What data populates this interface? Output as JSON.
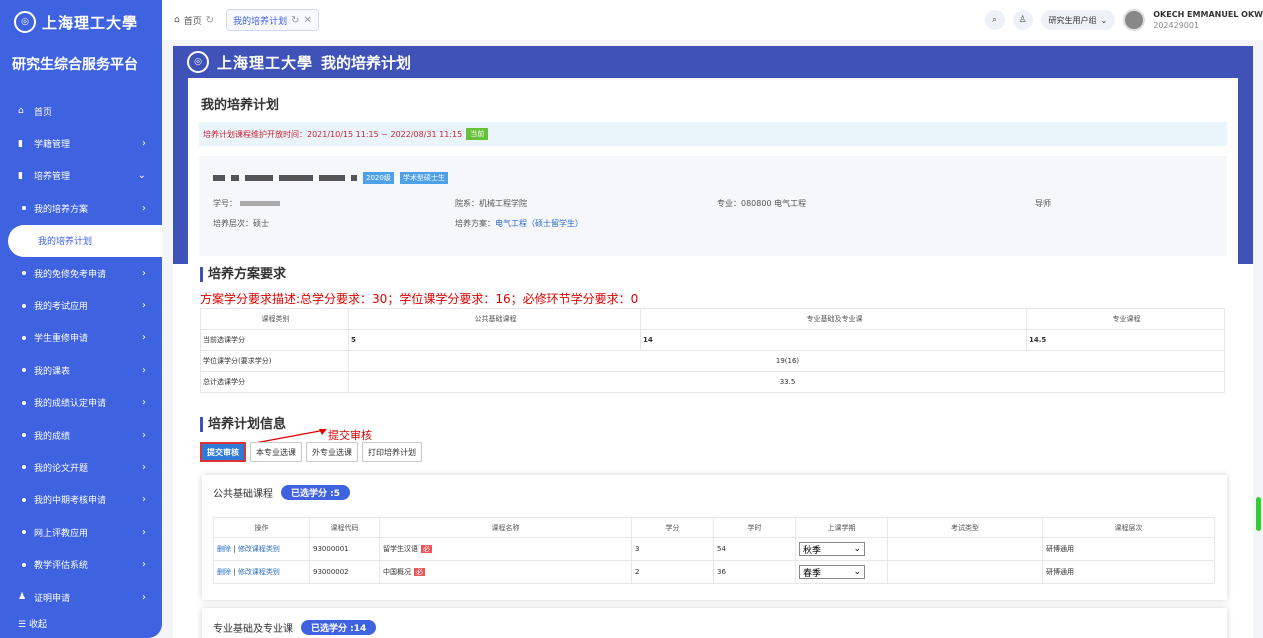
{
  "sidebar": {
    "logo_text": "上海理工大學",
    "platform_title": "研究生综合服务平台",
    "items": [
      {
        "label": "首页",
        "icon": "home-icon",
        "level": "top",
        "chevron": ""
      },
      {
        "label": "学籍管理",
        "icon": "chart-icon",
        "level": "top",
        "chevron": "›"
      },
      {
        "label": "培养管理",
        "icon": "chart-icon",
        "level": "top",
        "chevron": "⌄"
      },
      {
        "label": "我的培养方案",
        "level": "sub",
        "chevron": "›"
      },
      {
        "label": "我的培养计划",
        "level": "active",
        "chevron": ""
      },
      {
        "label": "我的免修免考申请",
        "level": "sub",
        "chevron": "›"
      },
      {
        "label": "我的考试应用",
        "level": "sub",
        "chevron": "›"
      },
      {
        "label": "学生重修申请",
        "level": "sub",
        "chevron": "›"
      },
      {
        "label": "我的课表",
        "level": "sub",
        "chevron": "›"
      },
      {
        "label": "我的成绩认定申请",
        "level": "sub",
        "chevron": "›"
      },
      {
        "label": "我的成绩",
        "level": "sub",
        "chevron": "›"
      },
      {
        "label": "我的论文开题",
        "level": "sub",
        "chevron": "›"
      },
      {
        "label": "我的中期考核申请",
        "level": "sub",
        "chevron": "›"
      },
      {
        "label": "网上评教应用",
        "level": "sub",
        "chevron": "›"
      },
      {
        "label": "教学评估系统",
        "level": "sub",
        "chevron": "›"
      },
      {
        "label": "证明申请",
        "icon": "person-icon",
        "level": "top",
        "chevron": "›"
      }
    ],
    "collapse_label": "收起"
  },
  "topbar": {
    "tabs": [
      {
        "label": "首页"
      },
      {
        "label": "我的培养计划"
      }
    ],
    "group_label": "研究生用户组",
    "user_name": "OKECH EMMANUEL OKW",
    "user_id": "202429001"
  },
  "banner": {
    "title": "我的培养计划",
    "logo_text": "上海理工大學"
  },
  "page": {
    "title": "我的培养计划",
    "notice": "培养计划课程维护开放时间：2021/10/15 11:15 ~ 2022/08/31 11:15",
    "notice_tag": "当前",
    "grade_tag": "2020级",
    "type_tag": "学术型硕士生",
    "student_no_label": "学号：",
    "college": "院系：机械工程学院",
    "major": "专业：080800 电气工程",
    "advisor_label": "导师",
    "level": "培养层次：硕士",
    "plan_label": "培养方案：",
    "plan_link": "电气工程（硕士留学生）"
  },
  "requirements": {
    "section_title": "培养方案要求",
    "desc": "方案学分要求描述:总学分要求：30；学位课学分要求：16；必修环节学分要求：0",
    "headers": [
      "课程类别",
      "公共基础课程",
      "专业基础及专业课",
      "专业课程"
    ],
    "row1": [
      "当前选课学分",
      "5",
      "14",
      "14.5"
    ],
    "row2": [
      "学位课学分(要求学分)",
      "19(16)"
    ],
    "row3": [
      "总计选课学分",
      "33.5"
    ]
  },
  "plan_info": {
    "section_title": "培养计划信息",
    "annotation": "提交审核",
    "buttons": [
      "提交审核",
      "本专业选课",
      "外专业选课",
      "打印培养计划"
    ]
  },
  "public_courses": {
    "title": "公共基础课程",
    "credit_pill": "已选学分 :5",
    "headers": [
      "操作",
      "课程代码",
      "课程名称",
      "学分",
      "学时",
      "上课学期",
      "考试类型",
      "课程层次"
    ],
    "rows": [
      {
        "op_delete": "删除",
        "op_sep": "|",
        "op_modify": "修改课程类别",
        "code": "93000001",
        "name": "留学生汉语",
        "badge": "必",
        "credit": "3",
        "hours": "54",
        "term": "秋季",
        "exam": "",
        "level": "研博通用"
      },
      {
        "op_delete": "删除",
        "op_sep": "|",
        "op_modify": "修改课程类别",
        "code": "93000002",
        "name": "中国概况",
        "badge": "必",
        "credit": "2",
        "hours": "36",
        "term": "春季",
        "exam": "",
        "level": "研博通用"
      }
    ]
  },
  "major_courses": {
    "title": "专业基础及专业课",
    "credit_pill": "已选学分 :14"
  }
}
